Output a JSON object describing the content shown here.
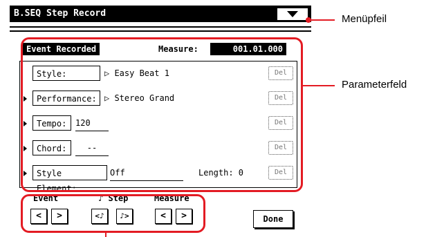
{
  "window": {
    "title": "B.SEQ Step Record"
  },
  "header": {
    "event_label": "Event Recorded",
    "measure_label": "Measure:",
    "measure_value": "001.01.000"
  },
  "rows": [
    {
      "param": "Style:",
      "value": "▷ Easy Beat 1",
      "del": "Del"
    },
    {
      "param": "Performance:",
      "value": "▷ Stereo Grand",
      "del": "Del"
    },
    {
      "param": "Tempo:",
      "value": "120",
      "del": "Del"
    },
    {
      "param": "Chord:",
      "value": "--",
      "del": "Del"
    },
    {
      "param": "Style Element:",
      "value": "Off",
      "length_label": "Length: 0",
      "del": "Del"
    }
  ],
  "nav": {
    "event": {
      "label": "Event",
      "prev": "<",
      "next": ">"
    },
    "step": {
      "label": "♪ Step",
      "prev": "<♪",
      "next": "♪>"
    },
    "measure": {
      "label": "Measure",
      "prev": "<",
      "next": ">"
    },
    "done": "Done"
  },
  "annotations": {
    "menu": "Menüpfeil",
    "params": "Parameterfeld"
  },
  "colors": {
    "callout": "#e31b23"
  }
}
